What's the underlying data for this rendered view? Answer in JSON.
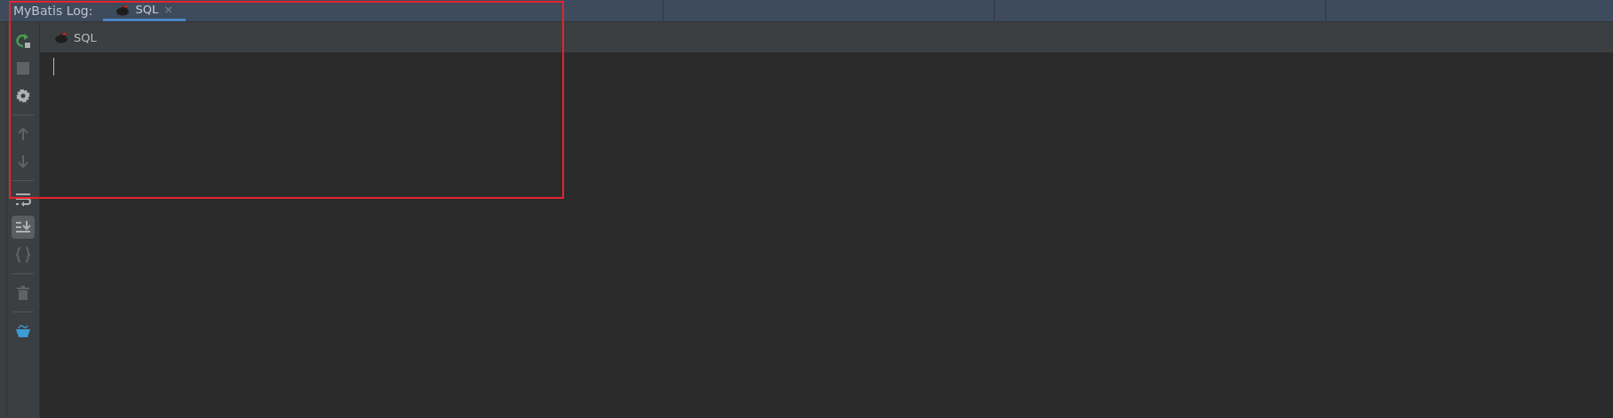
{
  "panel": {
    "title": "MyBatis Log:"
  },
  "tabs": [
    {
      "label": "SQL",
      "selected": true,
      "close": "×"
    }
  ],
  "toolbar": [
    {
      "kind": "rerun",
      "disabled": false
    },
    {
      "kind": "stop",
      "disabled": true
    },
    {
      "kind": "settings",
      "disabled": false
    },
    {
      "kind": "separator"
    },
    {
      "kind": "up",
      "disabled": true
    },
    {
      "kind": "down",
      "disabled": true
    },
    {
      "kind": "separator"
    },
    {
      "kind": "wrap",
      "disabled": false,
      "selected": false
    },
    {
      "kind": "scroll",
      "disabled": false,
      "selected": true
    },
    {
      "kind": "braces",
      "disabled": true
    },
    {
      "kind": "separator"
    },
    {
      "kind": "trash",
      "disabled": true
    },
    {
      "kind": "separator"
    },
    {
      "kind": "cup"
    }
  ],
  "console": {
    "header": "SQL",
    "caret": true
  },
  "annotation": {
    "color": "#e8222b"
  }
}
